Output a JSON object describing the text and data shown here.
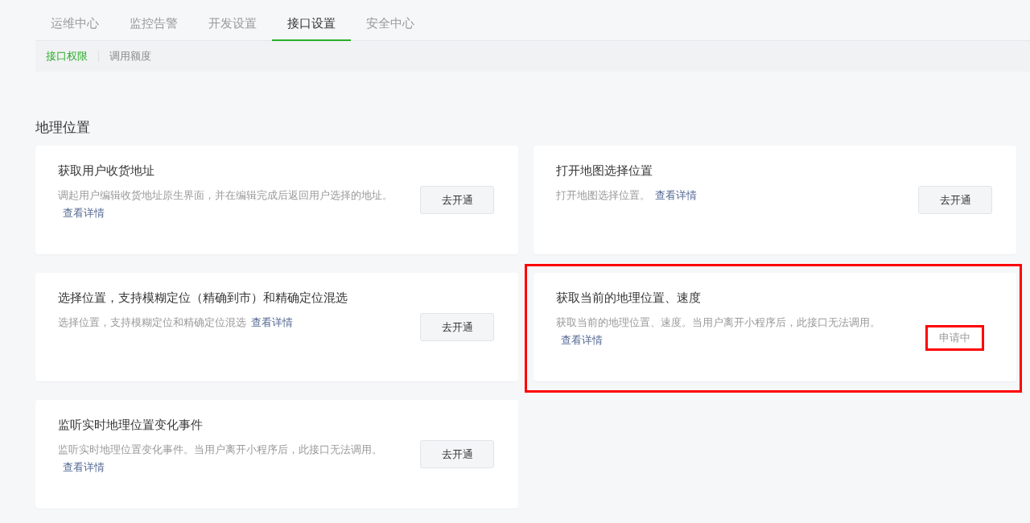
{
  "tabs": [
    {
      "label": "运维中心",
      "selected": false
    },
    {
      "label": "监控告警",
      "selected": false
    },
    {
      "label": "开发设置",
      "selected": false
    },
    {
      "label": "接口设置",
      "selected": true
    },
    {
      "label": "安全中心",
      "selected": false
    }
  ],
  "subtabs": [
    {
      "label": "接口权限",
      "selected": true
    },
    {
      "label": "调用额度",
      "selected": false
    }
  ],
  "section_title": "地理位置",
  "cards": [
    {
      "title": "获取用户收货地址",
      "description": "调起用户编辑收货地址原生界面，并在编辑完成后返回用户选择的地址。",
      "link": "查看详情",
      "action": {
        "kind": "button",
        "label": "去开通",
        "highlighted": false
      },
      "highlighted": false
    },
    {
      "title": "打开地图选择位置",
      "description": "打开地图选择位置。",
      "link": "查看详情",
      "action": {
        "kind": "button",
        "label": "去开通",
        "highlighted": false
      },
      "highlighted": false
    },
    {
      "title": "选择位置，支持模糊定位（精确到市）和精确定位混选",
      "description": "选择位置，支持模糊定位和精确定位混选",
      "link": "查看详情",
      "action": {
        "kind": "button",
        "label": "去开通",
        "highlighted": false
      },
      "highlighted": false
    },
    {
      "title": "获取当前的地理位置、速度",
      "description": "获取当前的地理位置、速度。当用户离开小程序后，此接口无法调用。",
      "link": "查看详情",
      "action": {
        "kind": "status",
        "label": "申请中",
        "highlighted": true
      },
      "highlighted": true
    },
    {
      "title": "监听实时地理位置变化事件",
      "description": "监听实时地理位置变化事件。当用户离开小程序后，此接口无法调用。",
      "link": "查看详情",
      "action": {
        "kind": "button",
        "label": "去开通",
        "highlighted": false
      },
      "highlighted": false
    }
  ]
}
